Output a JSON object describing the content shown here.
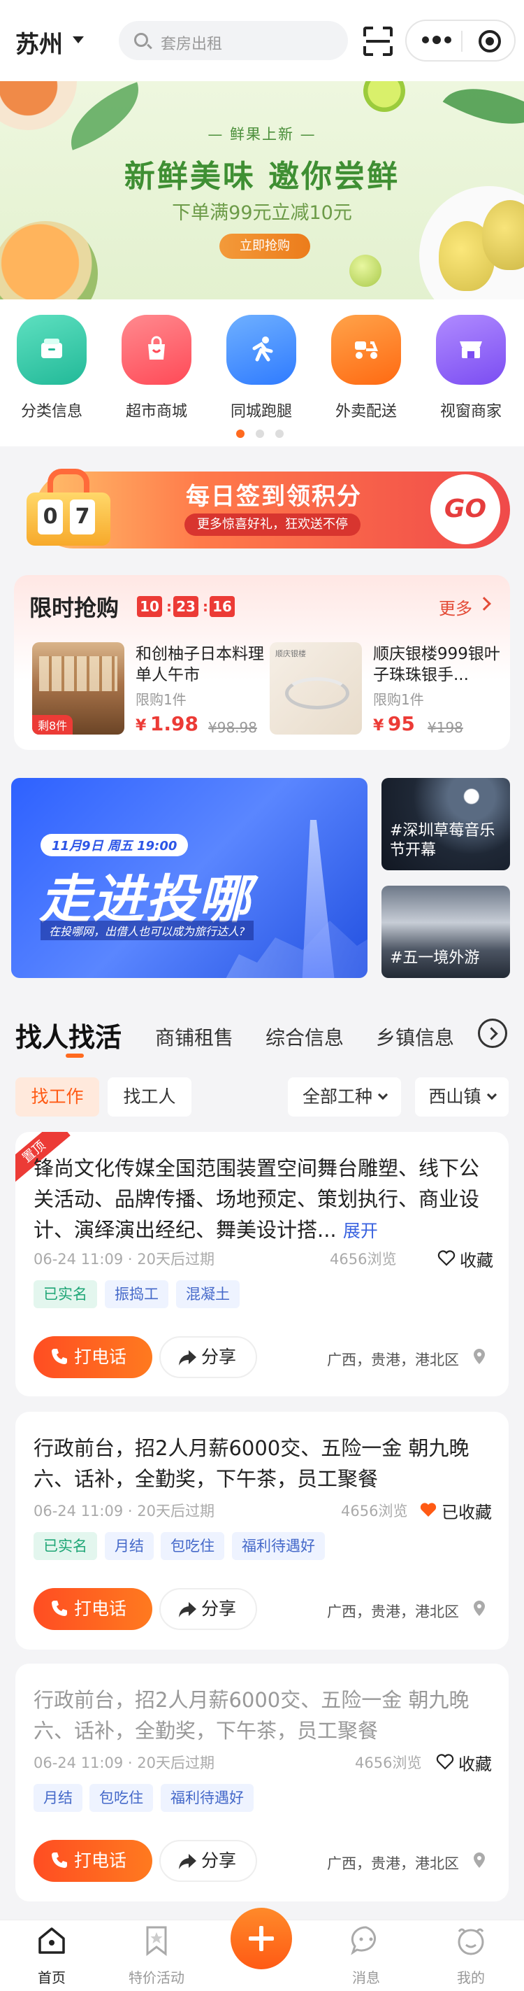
{
  "header": {
    "city": "苏州",
    "search_placeholder": "套房出租"
  },
  "banner": {
    "subtitle": "鲜果上新",
    "title": "新鲜美味 邀你尝鲜",
    "desc": "下单满99元立减10元",
    "button": "立即抢购"
  },
  "categories": [
    {
      "label": "分类信息",
      "icon": "category-icon",
      "color": "#2fc7a7"
    },
    {
      "label": "超市商城",
      "icon": "shopping-bag-icon",
      "color": "#ff5a63"
    },
    {
      "label": "同城跑腿",
      "icon": "runner-icon",
      "color": "#3d8bff"
    },
    {
      "label": "外卖配送",
      "icon": "scooter-icon",
      "color": "#ff7a1a"
    },
    {
      "label": "视窗商家",
      "icon": "store-icon",
      "color": "#8a5cf6"
    }
  ],
  "checkin": {
    "digits": [
      "0",
      "7"
    ],
    "title": "每日签到领积分",
    "subtitle": "更多惊喜好礼，狂欢送不停",
    "go": "GO"
  },
  "flash_sale": {
    "title": "限时抢购",
    "timer": [
      "10",
      "23",
      "16"
    ],
    "more": "更多",
    "products": [
      {
        "name": "和创柚子日本料理单人午市",
        "limit": "限购1件",
        "price_symbol": "¥",
        "price": "1.98",
        "original": "¥98.98",
        "stock_tag": "剩8件"
      },
      {
        "name": "顺庆银楼999银叶子珠珠银手...",
        "limit": "限购1件",
        "price_symbol": "¥",
        "price": "95",
        "original": "¥198",
        "stock_tag": ""
      }
    ]
  },
  "promos": {
    "main_date": "11月9日 周五 19:00",
    "main_title": "走进投哪",
    "main_caption": "在投哪网，出借人也可以成为旅行达人?",
    "side": [
      {
        "label": "#深圳草莓音乐节开幕"
      },
      {
        "label": "#五一境外游"
      }
    ]
  },
  "tabs": [
    "找人找活",
    "商铺租售",
    "综合信息",
    "乡镇信息"
  ],
  "filters": {
    "find_work": "找工作",
    "find_worker": "找工人",
    "job_type": "全部工种",
    "town": "西山镇"
  },
  "jobs": [
    {
      "ribbon": "置顶",
      "title": "锋尚文化传媒全国范围装置空间舞台雕塑、线下公关活动、品牌传播、场地预定、策划执行、商业设计、演绎演出经纪、舞美设计搭...",
      "expand": "展开",
      "meta": "06-24 11:09 · 20天后过期",
      "views": "4656浏览",
      "fav_label": "收藏",
      "favorited": false,
      "tags": [
        "已实名",
        "振捣工",
        "混凝土"
      ],
      "call": "打电话",
      "share": "分享",
      "location": "广西，贵港，港北区"
    },
    {
      "title": "行政前台，招2人月薪6000交、五险一金 朝九晚六、话补，全勤奖，下午茶，员工聚餐",
      "meta": "06-24 11:09 · 20天后过期",
      "views": "4656浏览",
      "fav_label": "已收藏",
      "favorited": true,
      "tags": [
        "已实名",
        "月结",
        "包吃住",
        "福利待遇好"
      ],
      "call": "打电话",
      "share": "分享",
      "location": "广西，贵港，港北区"
    },
    {
      "title": "行政前台，招2人月薪6000交、五险一金 朝九晚六、话补，全勤奖，下午茶，员工聚餐",
      "meta": "06-24 11:09 · 20天后过期",
      "views": "4656浏览",
      "fav_label": "收藏",
      "favorited": false,
      "tags": [
        "月结",
        "包吃住",
        "福利待遇好"
      ],
      "call": "打电话",
      "share": "分享",
      "location": "广西，贵港，港北区"
    }
  ],
  "bottom_nav": [
    {
      "label": "首页",
      "icon": "home-icon",
      "active": true
    },
    {
      "label": "特价活动",
      "icon": "bookmark-star-icon",
      "active": false
    },
    {
      "label": "",
      "icon": "plus-icon",
      "active": false
    },
    {
      "label": "消息",
      "icon": "message-icon",
      "active": false
    },
    {
      "label": "我的",
      "icon": "profile-icon",
      "active": false
    }
  ],
  "colors": {
    "accent": "#ff5a14",
    "price_red": "#ec3b36",
    "link_blue": "#3a63e0"
  }
}
